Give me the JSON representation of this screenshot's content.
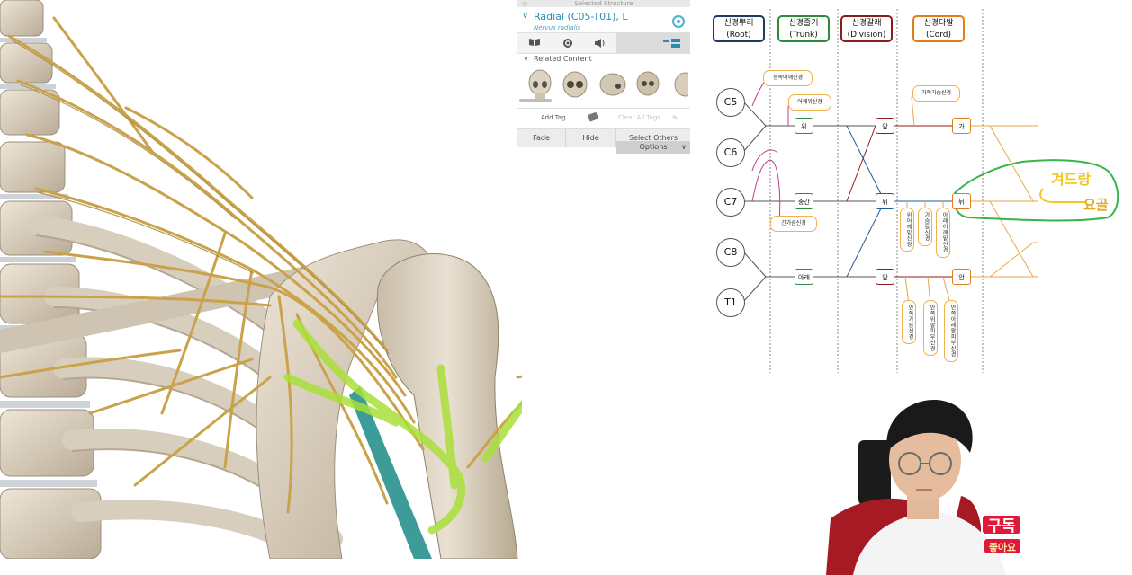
{
  "panel": {
    "header": "Selected Structure",
    "header_close": "‹|›",
    "structure_name": "Radial (C05-T01), L",
    "structure_latin": "Nervus radialis",
    "related_label": "Related Content",
    "add_tag": "Add Tag",
    "clear_tags": "Clear All Tags",
    "buttons": {
      "fade": "Fade",
      "hide": "Hide",
      "select_others": "Select Others",
      "options": "Options"
    },
    "accent_color": "#2a8bb5"
  },
  "diagram": {
    "headers": {
      "root": {
        "ko": "신경뿌리",
        "en": "(Root)",
        "color": "#1f3a5f"
      },
      "trunk": {
        "ko": "신경줄기",
        "en": "(Trunk)",
        "color": "#2e8b3a"
      },
      "division": {
        "ko": "신경갈래",
        "en": "(Division)",
        "color": "#8b1c1c"
      },
      "cord": {
        "ko": "신경다발",
        "en": "(Cord)",
        "color": "#e07c1a"
      }
    },
    "roots": [
      "C5",
      "C6",
      "C7",
      "C8",
      "T1"
    ],
    "trunks": [
      "위",
      "중간",
      "아래"
    ],
    "divisions": [
      "앞",
      "뒤",
      "앞"
    ],
    "cords": [
      "가",
      "뒤",
      "안"
    ],
    "nerves": {
      "dorsal_scapular": "등쪽어깨신경",
      "suprascapular": "어깨위신경",
      "long_thoracic": "긴가슴신경",
      "lateral_pectoral": "가쪽가슴신경",
      "upper_subscapular": "위어깨밑신경",
      "thoracodorsal": "가슴등신경",
      "lower_subscapular": "아래어깨밑신경",
      "medial_pectoral": "안쪽가슴신경",
      "medial_brachial_cutaneous": "안쪽위팔피부신경",
      "medial_antebrachial_cutaneous": "안쪽아래팔피부신경"
    },
    "handwriting": {
      "line1": "겨드랑",
      "line2": "요골"
    }
  },
  "webcam": {
    "badge_subscribe": "구독",
    "badge_like": "좋아요"
  }
}
